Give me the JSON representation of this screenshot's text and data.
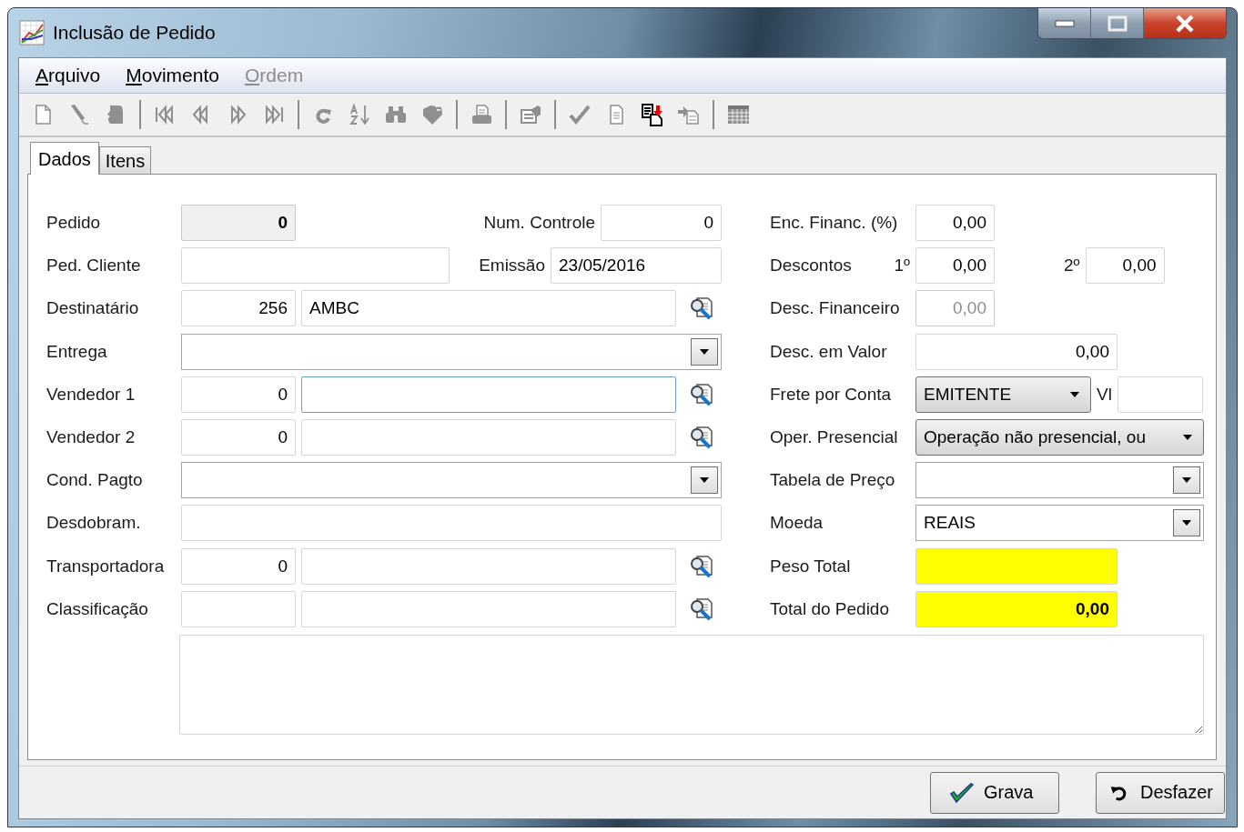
{
  "window": {
    "title": "Inclusão de Pedido"
  },
  "menu": [
    {
      "label": "Arquivo",
      "disabled": false
    },
    {
      "label": "Movimento",
      "disabled": false
    },
    {
      "label": "Ordem",
      "disabled": true
    }
  ],
  "toolbar": [
    {
      "kind": "new",
      "disabled": true
    },
    {
      "kind": "edit",
      "disabled": true
    },
    {
      "kind": "remove",
      "disabled": true
    },
    {
      "kind": "separator"
    },
    {
      "kind": "first",
      "disabled": true
    },
    {
      "kind": "previous",
      "disabled": true
    },
    {
      "kind": "next",
      "disabled": true
    },
    {
      "kind": "last",
      "disabled": true
    },
    {
      "kind": "separator"
    },
    {
      "kind": "refresh",
      "disabled": true
    },
    {
      "kind": "sort",
      "disabled": true
    },
    {
      "kind": "find",
      "disabled": true
    },
    {
      "kind": "filter",
      "disabled": true
    },
    {
      "kind": "separator"
    },
    {
      "kind": "print",
      "disabled": true
    },
    {
      "kind": "separator"
    },
    {
      "kind": "properties",
      "disabled": true
    },
    {
      "kind": "separator"
    },
    {
      "kind": "confirm",
      "disabled": true
    },
    {
      "kind": "page",
      "disabled": true
    },
    {
      "kind": "copy",
      "disabled": false
    },
    {
      "kind": "import",
      "disabled": true
    },
    {
      "kind": "separator"
    },
    {
      "kind": "grid",
      "disabled": true
    }
  ],
  "tabs": [
    {
      "label": "Dados",
      "selected": true
    },
    {
      "label": "Itens",
      "selected": false
    }
  ],
  "left_rows": [
    {
      "label": "Pedido",
      "lookup": false,
      "fields": [
        {
          "kind": "input",
          "value": "0",
          "disabled": true,
          "focused": false,
          "highlighted": false
        },
        {
          "kind": "label",
          "text": "Num. Controle"
        },
        {
          "kind": "input",
          "value": "0",
          "disabled": false,
          "focused": false,
          "highlighted": false
        }
      ]
    },
    {
      "label": "Ped. Cliente",
      "lookup": false,
      "fields": [
        {
          "kind": "input",
          "disabled": false,
          "focused": false,
          "highlighted": false
        },
        {
          "kind": "label",
          "text": "Emissão"
        },
        {
          "kind": "input",
          "value": "23/05/2016",
          "disabled": false,
          "focused": false,
          "highlighted": false
        }
      ]
    },
    {
      "label": "Destinatário",
      "lookup": true,
      "fields": [
        {
          "kind": "input",
          "value": "256",
          "disabled": false,
          "focused": false,
          "highlighted": false
        },
        {
          "kind": "input",
          "value": "AMBC",
          "disabled": false,
          "focused": false,
          "highlighted": false
        }
      ]
    },
    {
      "label": "Entrega",
      "lookup": false,
      "fields": [
        {
          "kind": "combo"
        }
      ]
    },
    {
      "label": "Vendedor 1",
      "lookup": true,
      "fields": [
        {
          "kind": "input",
          "value": "0",
          "disabled": false,
          "focused": false,
          "highlighted": false
        },
        {
          "kind": "input",
          "disabled": false,
          "focused": true,
          "highlighted": false
        }
      ]
    },
    {
      "label": "Vendedor 2",
      "lookup": true,
      "fields": [
        {
          "kind": "input",
          "value": "0",
          "disabled": false,
          "focused": false,
          "highlighted": false
        },
        {
          "kind": "input",
          "disabled": false,
          "focused": false,
          "highlighted": false
        }
      ]
    },
    {
      "label": "Cond. Pagto",
      "lookup": false,
      "fields": [
        {
          "kind": "combo"
        }
      ]
    },
    {
      "label": "Desdobram.",
      "lookup": false,
      "fields": [
        {
          "kind": "input",
          "disabled": false,
          "focused": false,
          "highlighted": false
        }
      ]
    },
    {
      "label": "Transportadora",
      "lookup": true,
      "fields": [
        {
          "kind": "input",
          "value": "0",
          "disabled": false,
          "focused": false,
          "highlighted": false
        },
        {
          "kind": "input",
          "disabled": false,
          "focused": false,
          "highlighted": false
        }
      ]
    },
    {
      "label": "Classificação",
      "lookup": true,
      "fields": [
        {
          "kind": "input",
          "disabled": false,
          "focused": false,
          "highlighted": false
        },
        {
          "kind": "input",
          "disabled": false,
          "focused": false,
          "highlighted": false
        }
      ]
    }
  ],
  "right_rows": [
    {
      "label": "Enc. Financ. (%)",
      "fields": [
        {
          "kind": "input",
          "value": "0,00",
          "disabled": false,
          "focused": false,
          "highlighted": false
        }
      ]
    },
    {
      "label": "Descontos",
      "sublabel": "1º",
      "fields": [
        {
          "kind": "input",
          "value": "0,00",
          "disabled": false,
          "focused": false,
          "highlighted": false
        },
        {
          "kind": "label",
          "text": "2º"
        },
        {
          "kind": "input",
          "value": "0,00",
          "disabled": false,
          "focused": false,
          "highlighted": false
        }
      ]
    },
    {
      "label": "Desc. Financeiro",
      "fields": [
        {
          "kind": "input",
          "value": "0,00",
          "disabled": true,
          "focused": false,
          "highlighted": false
        }
      ]
    },
    {
      "label": "Desc. em Valor",
      "fields": [
        {
          "kind": "input",
          "value": "0,00",
          "disabled": false,
          "focused": false,
          "highlighted": false
        }
      ]
    },
    {
      "label": "Frete por Conta",
      "fields": [
        {
          "kind": "dropdown",
          "value": "EMITENTE"
        },
        {
          "kind": "label",
          "text": "Vl"
        },
        {
          "kind": "input",
          "disabled": false,
          "focused": false,
          "highlighted": false
        }
      ]
    },
    {
      "label": "Oper. Presencial",
      "fields": [
        {
          "kind": "dropdown",
          "value": "Operação não presencial, ou"
        }
      ]
    },
    {
      "label": "Tabela de Preço",
      "fields": [
        {
          "kind": "combo"
        }
      ]
    },
    {
      "label": "Moeda",
      "fields": [
        {
          "kind": "combo",
          "value": "REAIS"
        }
      ]
    },
    {
      "label": "Peso Total",
      "fields": [
        {
          "kind": "input",
          "disabled": false,
          "focused": false,
          "highlighted": true
        }
      ]
    },
    {
      "label": "Total do Pedido",
      "fields": [
        {
          "kind": "input",
          "value": "0,00",
          "disabled": false,
          "focused": false,
          "highlighted": true
        }
      ]
    }
  ],
  "buttons": [
    {
      "label": "Grava",
      "kind": "save"
    },
    {
      "label": "Desfazer",
      "kind": "undo"
    }
  ]
}
